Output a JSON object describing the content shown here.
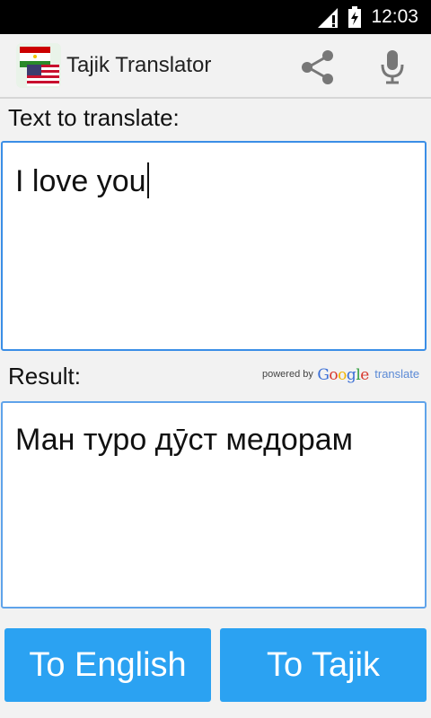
{
  "status_bar": {
    "time": "12:03",
    "icons": [
      "signal-icon",
      "battery-icon"
    ]
  },
  "app_bar": {
    "title": "Tajik Translator",
    "icons": [
      "flags-icon",
      "share-icon",
      "microphone-icon"
    ]
  },
  "input": {
    "label": "Text to translate:",
    "value": "I love you"
  },
  "result": {
    "label": "Result:",
    "value": "Ман туро дӯст медорам"
  },
  "attribution": {
    "powered_by": "powered by",
    "google": "Google",
    "translate": "translate"
  },
  "buttons": {
    "to_english": "To English",
    "to_tajik": "To Tajik"
  },
  "colors": {
    "accent": "#2ba2f2",
    "border": "#3a8ee6",
    "status_bar": "#000000",
    "background": "#f2f2f2"
  }
}
